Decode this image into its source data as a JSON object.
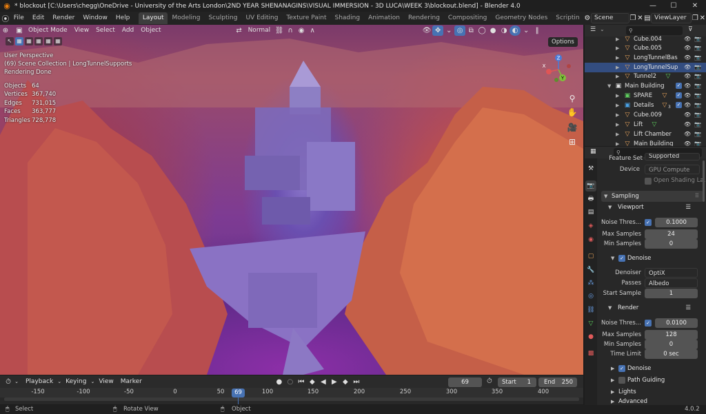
{
  "window": {
    "title": "* blockout [C:\\Users\\chegg\\OneDrive - University of the Arts London\\2ND YEAR SHENANAGINS\\VISUAL IMMERSION - 3D LUCA\\WEEK 3\\blockout.blend] - Blender 4.0",
    "minimize": "—",
    "maximize": "☐",
    "close": "✕"
  },
  "menu": [
    "File",
    "Edit",
    "Render",
    "Window",
    "Help"
  ],
  "workspaces": [
    "Layout",
    "Modeling",
    "Sculpting",
    "UV Editing",
    "Texture Paint",
    "Shading",
    "Animation",
    "Rendering",
    "Compositing",
    "Geometry Nodes",
    "Scriptin"
  ],
  "scene": "Scene",
  "view_layer": "ViewLayer",
  "viewport": {
    "mode": "Object Mode",
    "menus": [
      "View",
      "Select",
      "Add",
      "Object"
    ],
    "orientation": "Normal",
    "options": "Options",
    "overlay": {
      "line1": "User Perspective",
      "line2": "(69) Scene Collection | LongTunnelSupports",
      "line3": "Rendering Done"
    },
    "stats": [
      {
        "label": "Objects",
        "value": "64"
      },
      {
        "label": "Vertices",
        "value": "367,740"
      },
      {
        "label": "Edges",
        "value": "731,015"
      },
      {
        "label": "Faces",
        "value": "363,777"
      },
      {
        "label": "Triangles",
        "value": "728,778"
      }
    ],
    "gizmo": {
      "x": "X",
      "y": "Y",
      "z": "Z"
    }
  },
  "outliner": {
    "rows": [
      {
        "label": "Cube.004",
        "icon": "mesh-icon"
      },
      {
        "label": "Cube.005",
        "icon": "mesh-icon"
      },
      {
        "label": "LongTunnelBas",
        "icon": "mesh-icon"
      },
      {
        "label": "LongTunnelSup",
        "icon": "mesh-icon"
      },
      {
        "label": "Tunnel2",
        "icon": "mesh-icon"
      },
      {
        "label": "Main Building",
        "icon": "collection-icon"
      },
      {
        "label": "SPARE",
        "icon": "collection-icon"
      },
      {
        "label": "Details",
        "icon": "collection-icon",
        "count": "3"
      },
      {
        "label": "Cube.009",
        "icon": "mesh-icon"
      },
      {
        "label": "Lift",
        "icon": "mesh-icon"
      },
      {
        "label": "Lift Chamber",
        "icon": "mesh-icon"
      },
      {
        "label": "Main Building",
        "icon": "mesh-icon"
      }
    ]
  },
  "properties": {
    "feature_set_label": "Feature Set",
    "feature_set": "Supported",
    "device_label": "Device",
    "device": "GPU Compute",
    "open_shading": "Open Shading La...",
    "sampling": "Sampling",
    "viewport_section": "Viewport",
    "vp_noise_label": "Noise Thres...",
    "vp_noise": "0.1000",
    "vp_max_label": "Max Samples",
    "vp_max": "24",
    "vp_min_label": "Min Samples",
    "vp_min": "0",
    "denoise": "Denoise",
    "denoiser_label": "Denoiser",
    "denoiser": "OptiX",
    "passes_label": "Passes",
    "passes": "Albedo",
    "start_label": "Start Sample",
    "start": "1",
    "render_section": "Render",
    "r_noise_label": "Noise Thres...",
    "r_noise": "0.0100",
    "r_max_label": "Max Samples",
    "r_max": "128",
    "r_min_label": "Min Samples",
    "r_min": "0",
    "time_label": "Time Limit",
    "time": "0 sec",
    "r_denoise": "Denoise",
    "path_guiding": "Path Guiding",
    "lights": "Lights",
    "advanced": "Advanced"
  },
  "timeline": {
    "menus": [
      "Playback",
      "Keying",
      "View",
      "Marker"
    ],
    "current_frame": "69",
    "start_label": "Start",
    "start": "1",
    "end_label": "End",
    "end": "250",
    "ticks": [
      "-150",
      "-100",
      "-50",
      "0",
      "50",
      "69",
      "100",
      "150",
      "200",
      "250",
      "300",
      "350",
      "400"
    ]
  },
  "status": {
    "select": "Select",
    "rotate": "Rotate View",
    "object": "Object",
    "version": "4.0.2"
  }
}
